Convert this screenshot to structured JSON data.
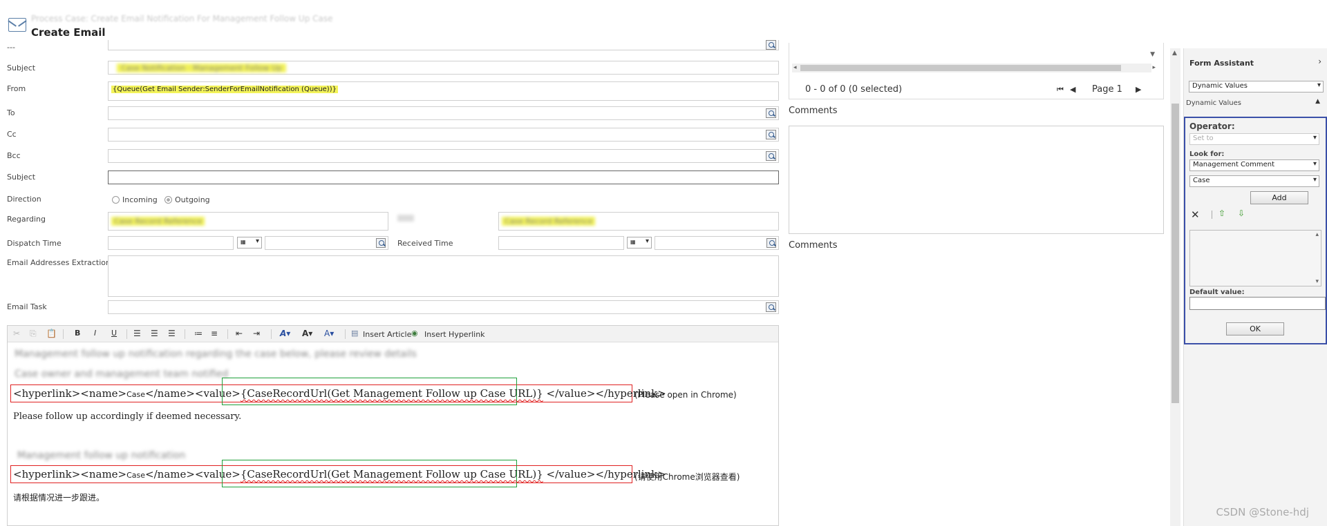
{
  "header": {
    "subtitle": "Process Case: Create Email Notification For Management Follow Up Case",
    "title": "Create Email"
  },
  "form": {
    "top_label": "---",
    "subject_label": "Subject",
    "subject_value": "Case Notification · Management Follow Up",
    "from_label": "From",
    "from_value": "{Queue(Get Email Sender:SenderForEmailNotification (Queue))}",
    "to_label": "To",
    "cc_label": "Cc",
    "bcc_label": "Bcc",
    "subject2_label": "Subject",
    "direction_label": "Direction",
    "direction_incoming": "Incoming",
    "direction_outgoing": "Outgoing",
    "regarding_label": "Regarding",
    "regarding_value": "Case Record Reference",
    "regarding_right_value": "Case Record Reference",
    "dispatch_label": "Dispatch Time",
    "received_label": "Received Time",
    "extraction_label": "Email Addresses Extraction",
    "task_label": "Email Task"
  },
  "toolbar": {
    "insert_article": "Insert Article",
    "insert_hyperlink": "Insert Hyperlink"
  },
  "editor": {
    "blur1": "Management follow up notification regarding the case below, please review details",
    "blur2": "Case owner and management team notified",
    "open_tag": "<hyperlink><name>",
    "case_word": "Case",
    "mid_tag": "</name><value>",
    "url_token": "{CaseRecordUrl(Get Management Follow up Case URL)}",
    "close_tag": "</value></hyperlink>",
    "note_en": "(Please open in Chrome)",
    "followup_en": "Please follow up accordingly if deemed necessary.",
    "blur3": "Management follow up notification",
    "note_cn": "(请使用Chrome浏览器查看)",
    "followup_cn": "请根据情况进一步跟进。"
  },
  "middle": {
    "pager_text": "0 - 0 of 0 (0 selected)",
    "page_label": "Page 1",
    "comments1": "Comments",
    "comments2": "Comments"
  },
  "assistant": {
    "title": "Form Assistant",
    "mode_select": "Dynamic Values",
    "section": "Dynamic Values",
    "operator_label": "Operator:",
    "operator_value": "Set to",
    "lookfor_label": "Look for:",
    "lookfor_value": "Management Comment",
    "entity_value": "Case",
    "add_button": "Add",
    "default_label": "Default value:",
    "ok_button": "OK"
  },
  "watermark": "CSDN @Stone-hdj"
}
